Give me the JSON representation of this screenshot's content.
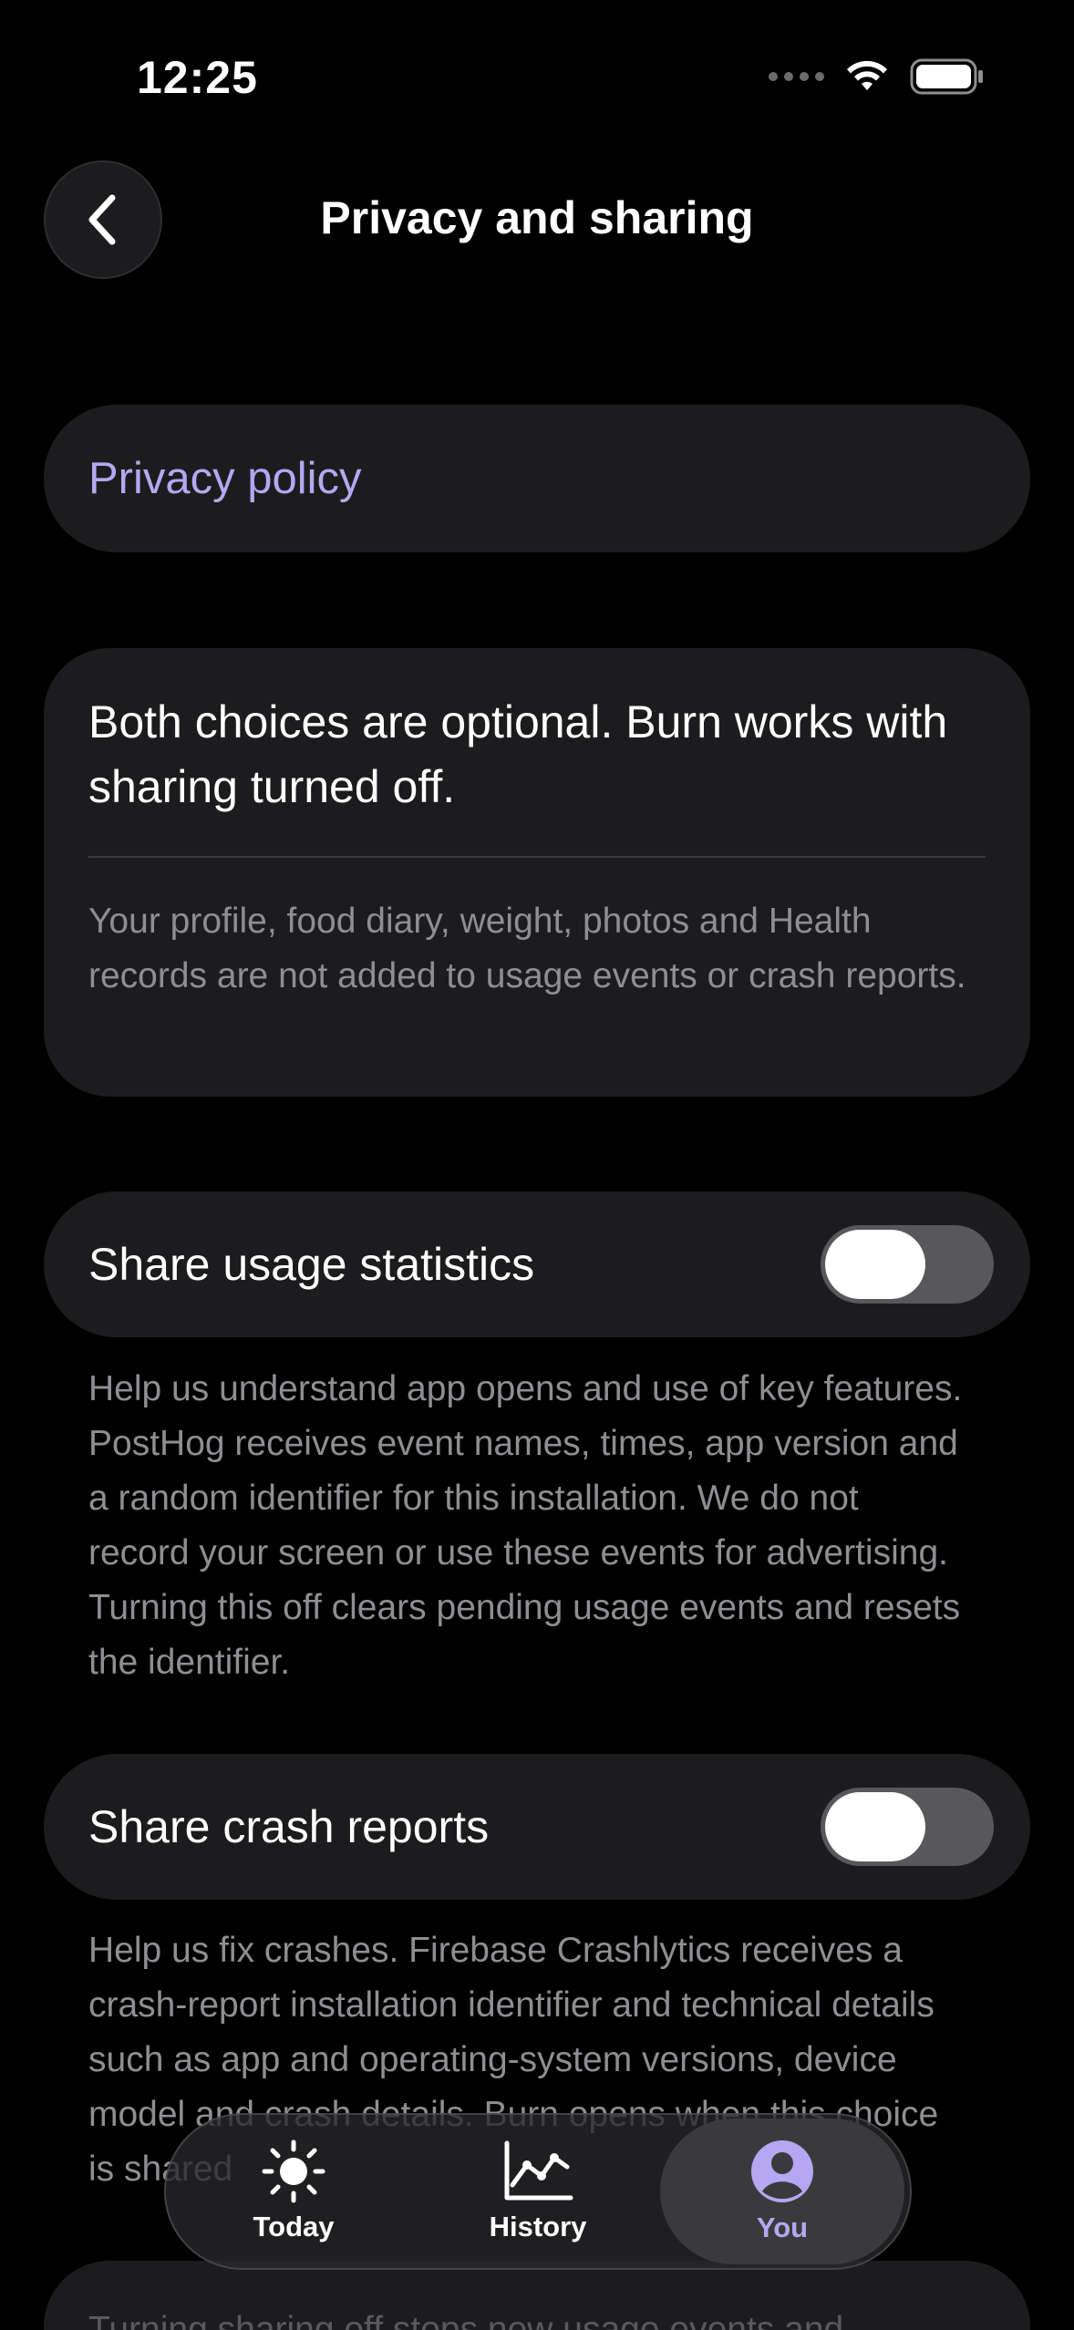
{
  "status_bar": {
    "time": "12:25"
  },
  "header": {
    "title": "Privacy and sharing",
    "back_icon": "chevron-left-icon"
  },
  "privacy_policy": {
    "label": "Privacy policy",
    "color": "#b6a7f2"
  },
  "info": {
    "main": "Both choices are optional. Burn works with sharing turned off.",
    "sub": "Your profile, food diary, weight, photos and Health records are not added to usage events or crash reports."
  },
  "usage": {
    "label": "Share usage statistics",
    "enabled": false,
    "description": "Help us understand app opens and use of key features. PostHog receives event names, times, app version and a random identifier for this installation. We do not record your screen or use these events for advertising. Turning this off clears pending usage events and resets the identifier."
  },
  "crash": {
    "label": "Share crash reports",
    "enabled": false,
    "description": "Help us fix crashes. Firebase Crashlytics receives a crash-report installation identifier and technical details such as app and operating-system versions, device model and crash details. Burn opens when this choice is shared"
  },
  "footer_note": "Turning sharing off stops new usage events and",
  "tab_bar": {
    "tabs": [
      {
        "label": "Today",
        "icon": "sun-icon",
        "active": false
      },
      {
        "label": "History",
        "icon": "chart-line-icon",
        "active": false
      },
      {
        "label": "You",
        "icon": "profile-icon",
        "active": true
      }
    ],
    "accent": "#b6a7f2"
  }
}
